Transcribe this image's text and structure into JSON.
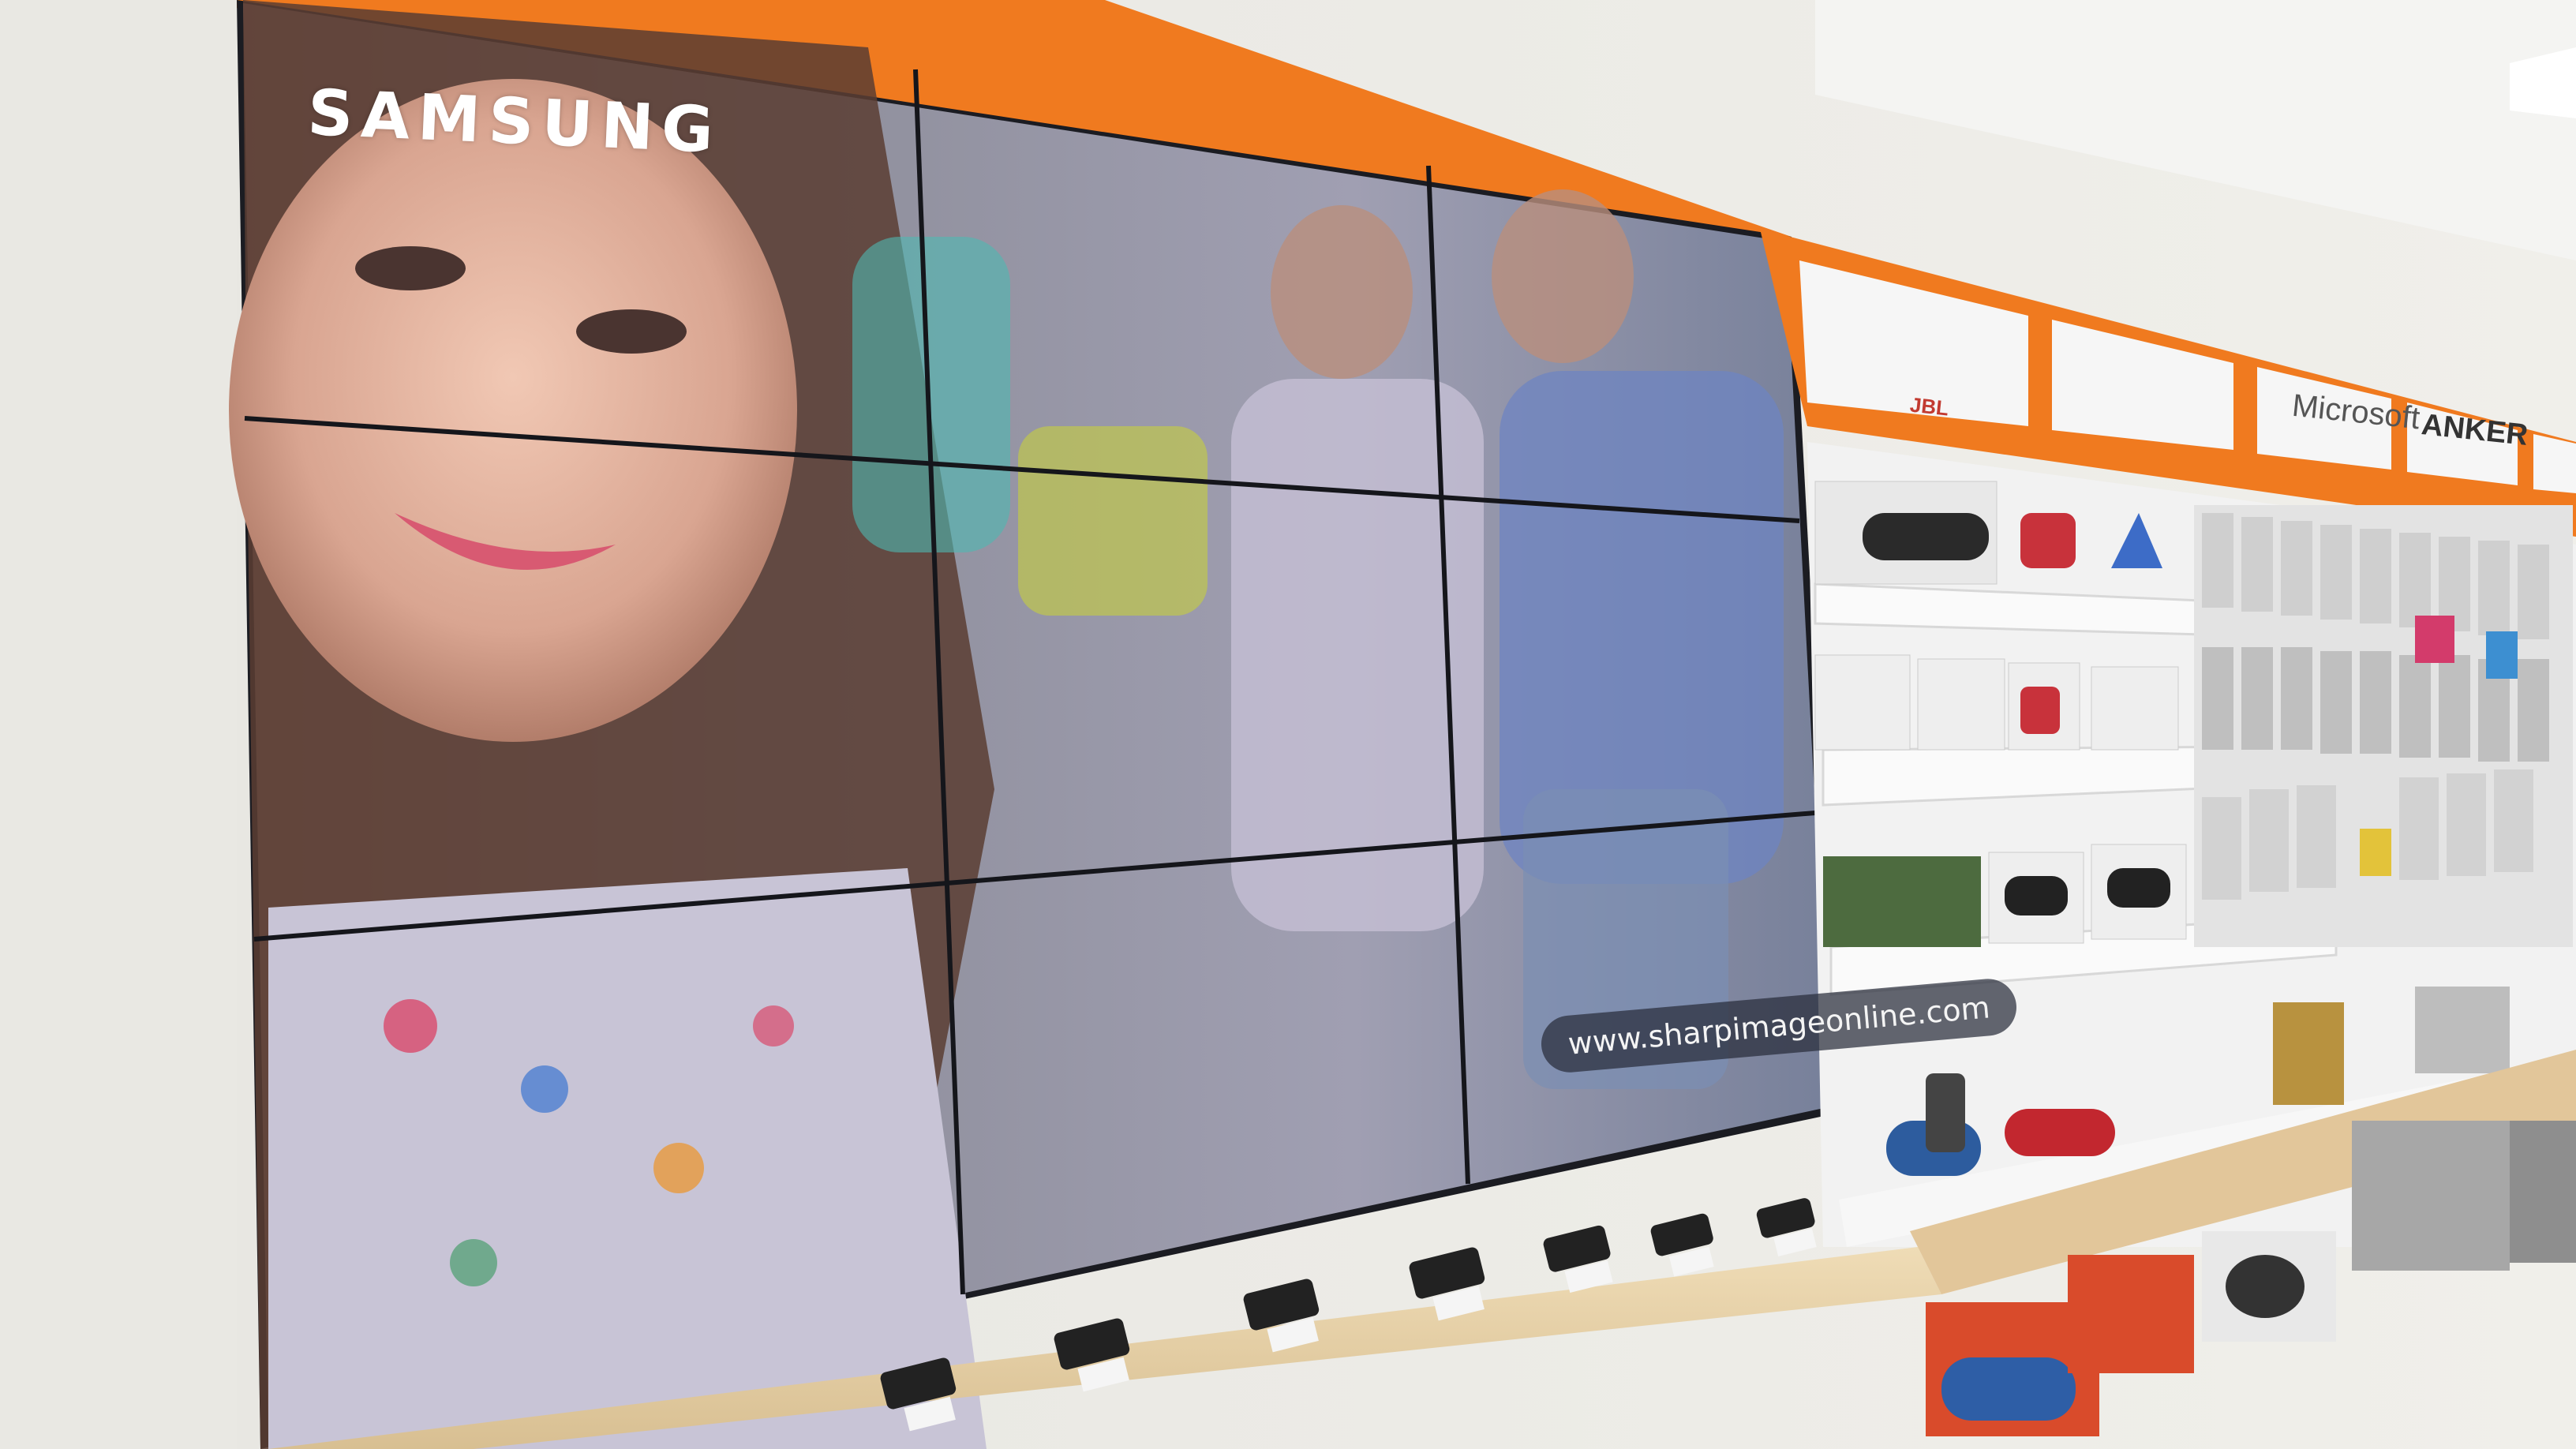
{
  "scene": {
    "description_free": true
  },
  "video_wall": {
    "brand_text": "SAMSUNG",
    "url_text": "www.sharpimageonline.com"
  },
  "shelf_signs": {
    "sign_1": "JBL",
    "sign_2": "",
    "sign_3": "Microsoft",
    "sign_4": "ANKER"
  },
  "colors": {
    "wall": "#ecebe6",
    "ceiling": "#f3f3f1",
    "accent_orange": "#f07a1f",
    "shelf_white": "#f6f6f6",
    "counter_wood": "#e6cfa6",
    "screen_bezel": "#1b1c22"
  }
}
